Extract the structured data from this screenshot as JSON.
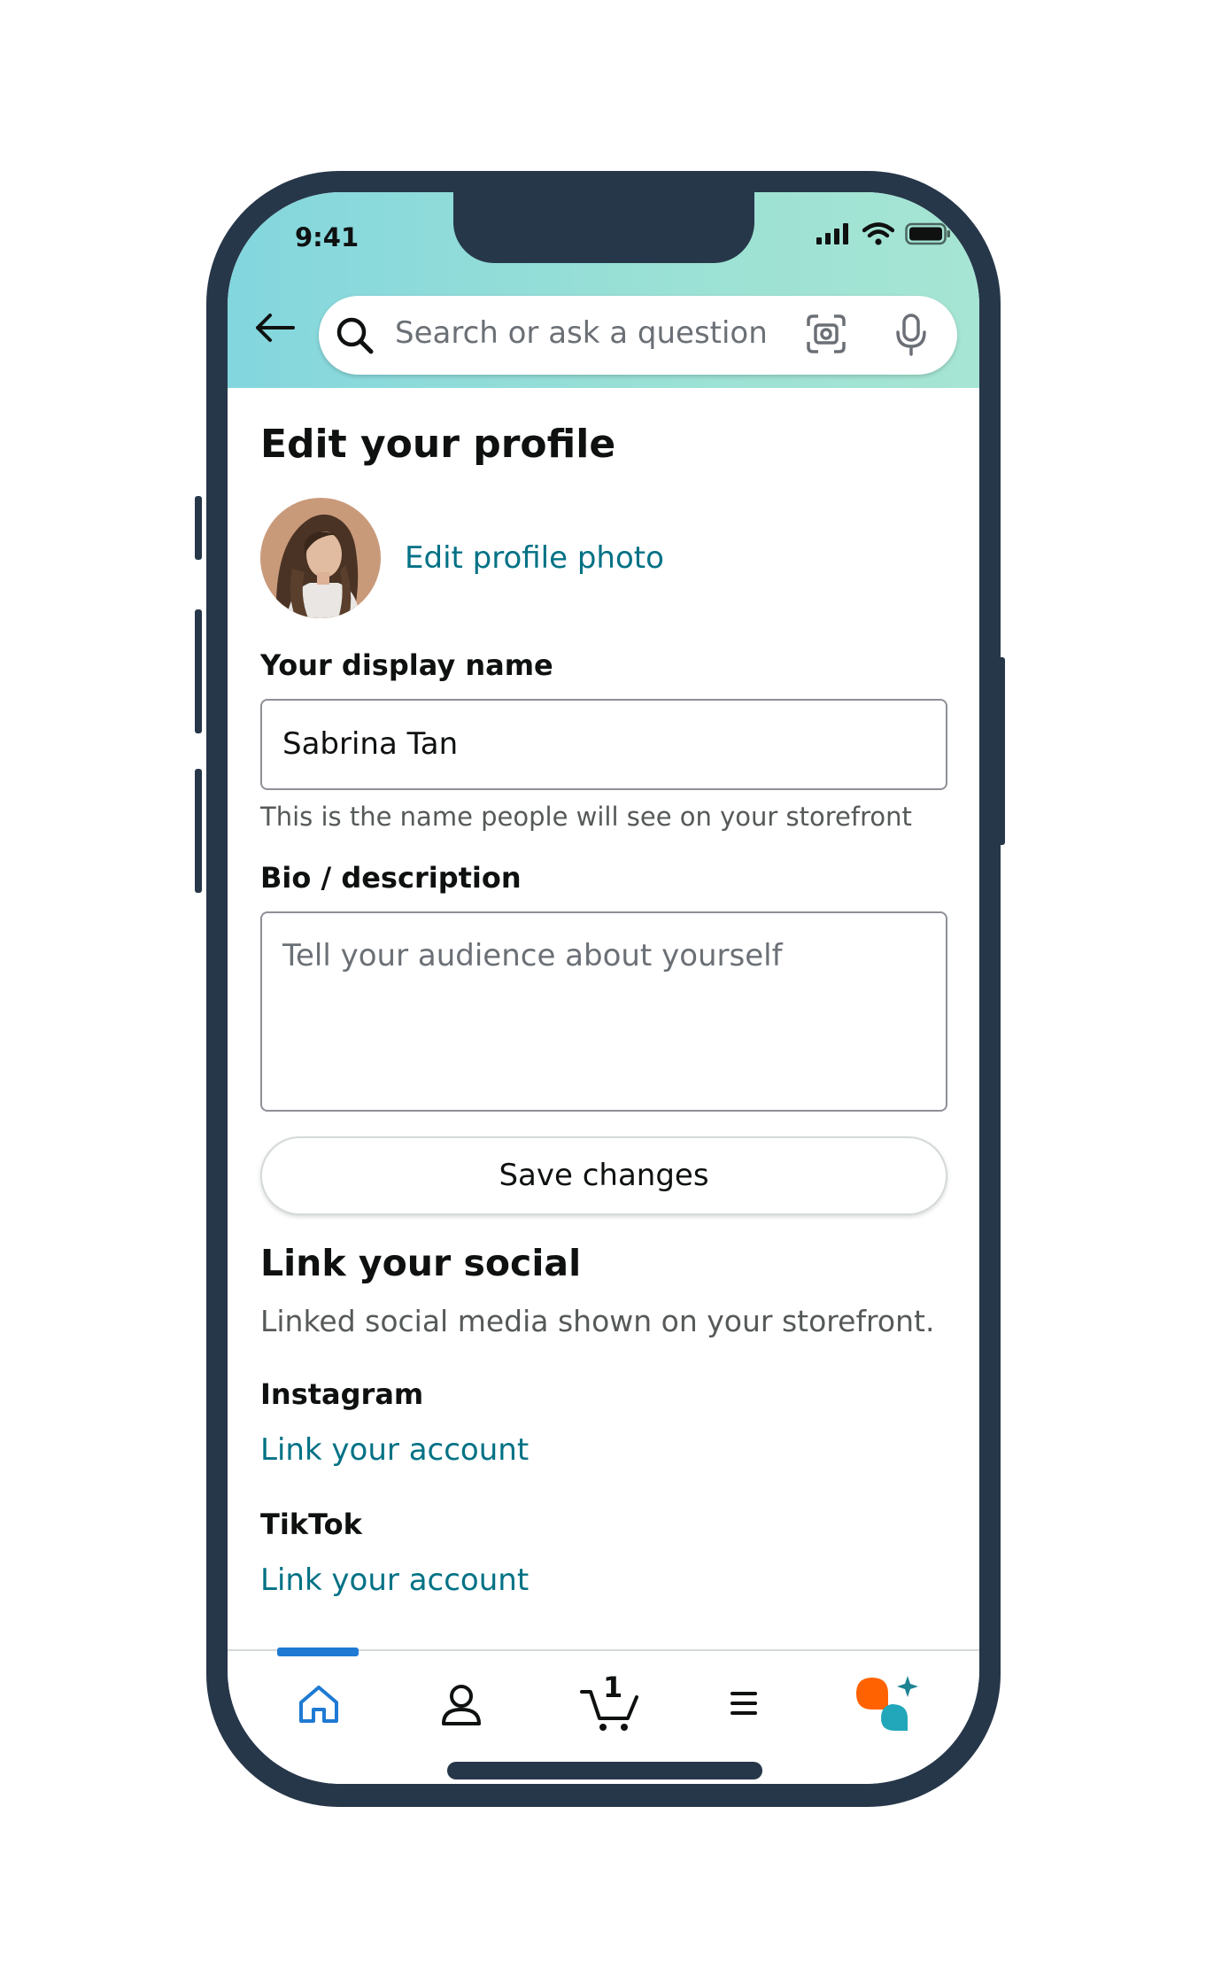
{
  "status_bar": {
    "time": "9:41"
  },
  "search": {
    "placeholder": "Search or ask a question"
  },
  "page": {
    "title": "Edit your profile",
    "edit_photo_link": "Edit profile photo",
    "display_name": {
      "label": "Your display name",
      "value": "Sabrina Tan",
      "hint": "This is the name people will see on your storefront"
    },
    "bio": {
      "label": "Bio / description",
      "placeholder": "Tell your audience about yourself"
    },
    "save_button": "Save changes"
  },
  "social": {
    "title": "Link your social",
    "subtitle": "Linked social media shown on your storefront.",
    "platforms": [
      {
        "name": "Instagram",
        "link": "Link your account"
      },
      {
        "name": "TikTok",
        "link": "Link your account"
      }
    ]
  },
  "bottom_nav": {
    "items": [
      {
        "icon": "home-icon",
        "active": true
      },
      {
        "icon": "account-icon"
      },
      {
        "icon": "cart-icon",
        "badge": "1"
      },
      {
        "icon": "menu-icon"
      },
      {
        "icon": "rufus-assistant-icon"
      }
    ]
  },
  "colors": {
    "link": "#007185",
    "frame": "#27374a",
    "header_gradient_start": "#83d6de",
    "header_gradient_end": "#a6e5d3",
    "nav_active": "#1e7ad3",
    "assistant_orange": "#ff6200",
    "assistant_teal": "#21a7b9"
  }
}
